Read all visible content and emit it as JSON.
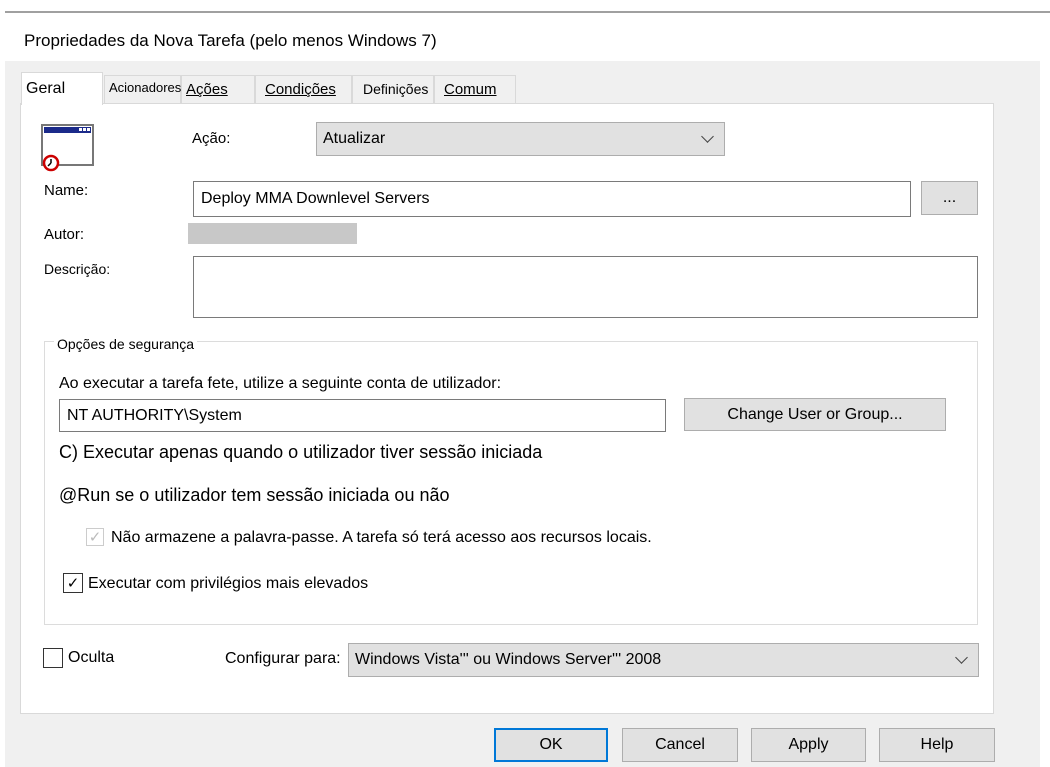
{
  "window": {
    "title": "Propriedades da Nova Tarefa (pelo menos Windows 7)"
  },
  "tabs": [
    {
      "label": "Geral"
    },
    {
      "label": "Acionadores"
    },
    {
      "label": "Ações"
    },
    {
      "label": "Condições"
    },
    {
      "label": "Definições"
    },
    {
      "label": "Comum"
    }
  ],
  "general": {
    "action_label": "Ação:",
    "action_value": "Atualizar",
    "name_label": "Name:",
    "name_value": "Deploy MMA Downlevel Servers",
    "browse_label": "...",
    "author_label": "Autor:",
    "description_label": "Descrição:",
    "description_value": ""
  },
  "security": {
    "legend": "Opções de segurança",
    "account_prompt": "Ao executar a tarefa fete, utilize a seguinte conta de utilizador:",
    "account_value": "NT AUTHORITY\\System",
    "change_user_label": "Change User or Group...",
    "run_logged_on": "C) Executar apenas quando o utilizador tiver sessão iniciada",
    "run_whether": "@Run se o utilizador tem sessão iniciada ou não",
    "no_store_password": "Não armazene a palavra-passe. A tarefa só terá acesso aos recursos locais.",
    "no_store_password_checked": true,
    "highest_privileges": "Executar com privilégios mais elevados",
    "highest_privileges_checked": true
  },
  "hidden": {
    "label": "Oculta",
    "checked": false
  },
  "configure": {
    "label": "Configurar para:",
    "value": "Windows Vista''' ou Windows Server''' 2008"
  },
  "buttons": {
    "ok": "OK",
    "cancel": "Cancel",
    "apply": "Apply",
    "help": "Help"
  }
}
